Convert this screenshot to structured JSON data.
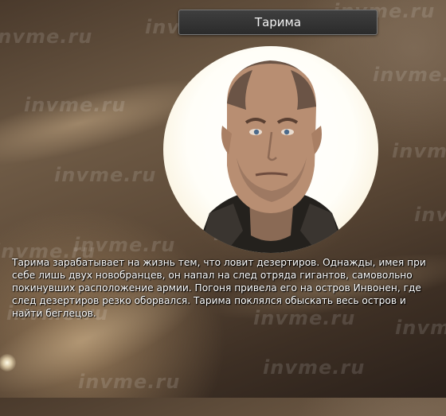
{
  "character": {
    "name": "Тарима",
    "bio_lines": [
      "Тарима зарабатывает на жизнь тем, что ловит дезертиров. Однажды, имея при",
      "себе лишь двух новобранцев, он напал на след отряда гигантов, самовольно",
      "покинувших расположение армии. Погоня привела его на остров Инвонен, где",
      "след дезертиров резко оборвался. Тарима поклялся обыскать весь остров и",
      "найти беглецов."
    ]
  },
  "watermark": {
    "text": "invme.ru"
  },
  "colors": {
    "title_bg": "#333333",
    "title_border": "#777777",
    "text": "#ffffff"
  }
}
